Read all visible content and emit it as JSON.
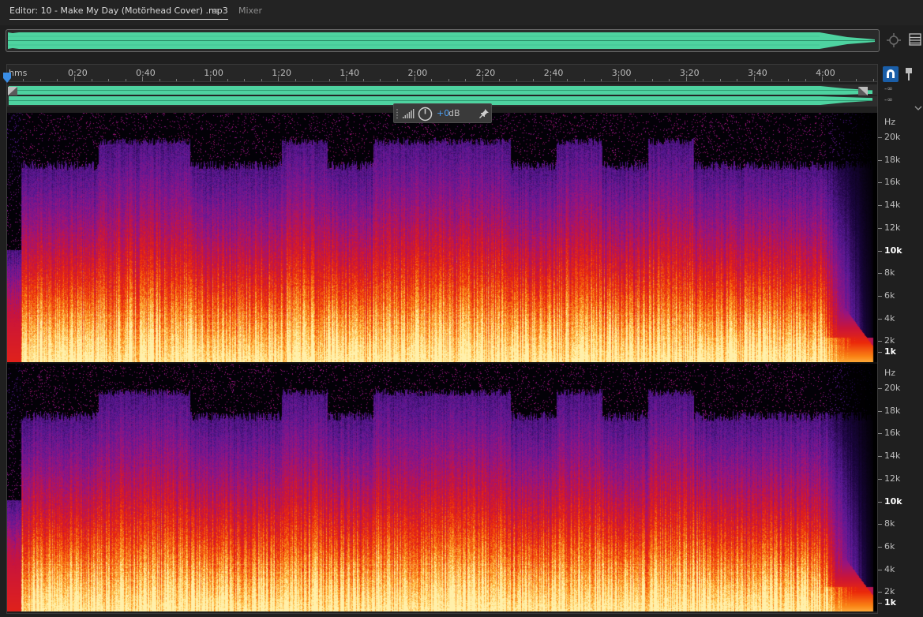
{
  "tabs": {
    "editor_label": "Editor: 10 - Make My Day (Motörhead Cover) .mp3",
    "menu_glyph": "≡",
    "mixer_label": "Mixer"
  },
  "ruler": {
    "unit_label": "hms",
    "marks": [
      "0:20",
      "0:40",
      "1:00",
      "1:20",
      "1:40",
      "2:00",
      "2:20",
      "2:40",
      "3:00",
      "3:20",
      "3:40",
      "4:00"
    ]
  },
  "wave": {
    "channel_db_labels": [
      "-∞",
      "-∞"
    ]
  },
  "hud": {
    "value": "+0",
    "unit": "dB"
  },
  "frequency_scale": {
    "unit": "Hz",
    "labels": [
      "20k",
      "18k",
      "16k",
      "14k",
      "12k",
      "10k",
      "8k",
      "6k",
      "4k",
      "2k",
      "1k"
    ],
    "emphasized": [
      "10k",
      "1k"
    ]
  },
  "icons": {
    "overview_zoom": "zoom-to-selection-icon",
    "panel_menu": "panel-menu-icon",
    "snap": "snap-magnet-icon",
    "marker": "marker-pin-icon",
    "hud_meter": "level-meter-icon",
    "hud_knob": "volume-knob-icon",
    "hud_pin": "pin-icon"
  },
  "colors": {
    "waveform": "#4ed3a0",
    "accent": "#1a5ea8",
    "hud_value": "#4a9ff5"
  }
}
